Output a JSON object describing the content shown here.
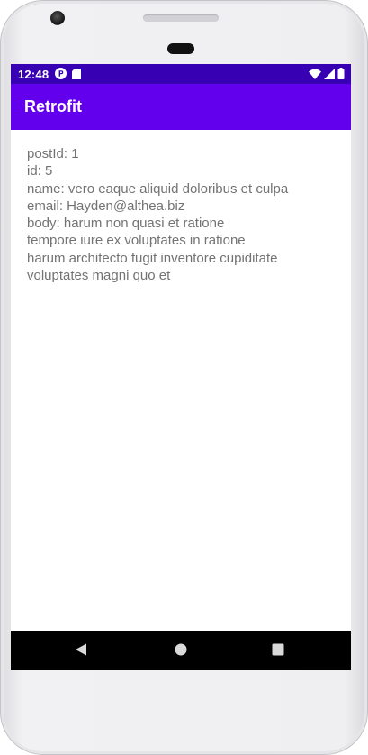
{
  "status_bar": {
    "time": "12:48",
    "icons_left": [
      "notification-p-icon",
      "sd-card-icon"
    ],
    "icons_right": [
      "wifi-icon",
      "signal-icon",
      "battery-icon"
    ],
    "background_color": "#3700b3"
  },
  "app_bar": {
    "title": "Retrofit",
    "background_color": "#6200ee"
  },
  "post": {
    "post_id": "postId: 1",
    "id": "id: 5",
    "name": "name: vero eaque aliquid doloribus et culpa",
    "email": "email: Hayden@althea.biz",
    "body_lines": [
      "body: harum non quasi et ratione",
      "tempore iure ex voluptates in ratione",
      "harum architecto fugit inventore cupiditate",
      "voluptates magni quo et"
    ]
  },
  "nav_bar": {
    "buttons": [
      "back-icon",
      "home-icon",
      "recents-icon"
    ]
  }
}
